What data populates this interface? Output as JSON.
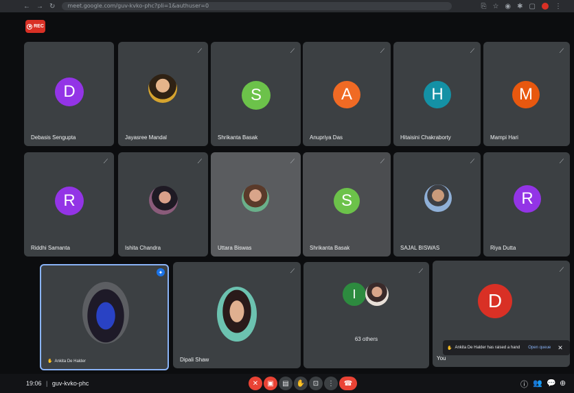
{
  "browser": {
    "url": "meet.google.com/guv-kvko-phc?pli=1&authuser=0"
  },
  "recording": {
    "label": "REC"
  },
  "participants": [
    {
      "name": "Debasis Sengupta",
      "initial": "D",
      "color": "#9334e6"
    },
    {
      "name": "Jayasree Mandal",
      "initial": "",
      "color": "#6b5a32"
    },
    {
      "name": "Shrikanta Basak",
      "initial": "S",
      "color": "#6cc24a"
    },
    {
      "name": "Anupriya Das",
      "initial": "A",
      "color": "#f06a24"
    },
    {
      "name": "Hitaisini Chakraborty",
      "initial": "H",
      "color": "#1491a5"
    },
    {
      "name": "Mampi Hari",
      "initial": "M",
      "color": "#e8580f"
    },
    {
      "name": "Riddhi Samanta",
      "initial": "R",
      "color": "#9334e6"
    },
    {
      "name": "Ishita Chandra",
      "initial": "",
      "color": "#6a3b44"
    },
    {
      "name": "Uttara Biswas",
      "initial": "",
      "color": "#a88a6e"
    },
    {
      "name": "Shrikanta Basak",
      "initial": "S",
      "color": "#6cc24a"
    },
    {
      "name": "SAJAL BISWAS",
      "initial": "",
      "color": "#7f8b8f"
    },
    {
      "name": "Riya Dutta",
      "initial": "R",
      "color": "#9334e6"
    },
    {
      "name": "Ankita De Halder",
      "initial": "",
      "color": "#2a1f33"
    },
    {
      "name": "Dipali Shaw",
      "initial": "",
      "color": "#1e8d8c"
    },
    {
      "name": "63 others",
      "initial": "I",
      "color": "#2d8b3f"
    },
    {
      "name": "You",
      "initial": "D",
      "color": "#d93025"
    }
  ],
  "meeting": {
    "time": "19:06",
    "separator": "|",
    "code": "guv-kvko-phc"
  },
  "toast": {
    "message": "Ankita De Halder has raised a hand",
    "action": "Open queue"
  }
}
